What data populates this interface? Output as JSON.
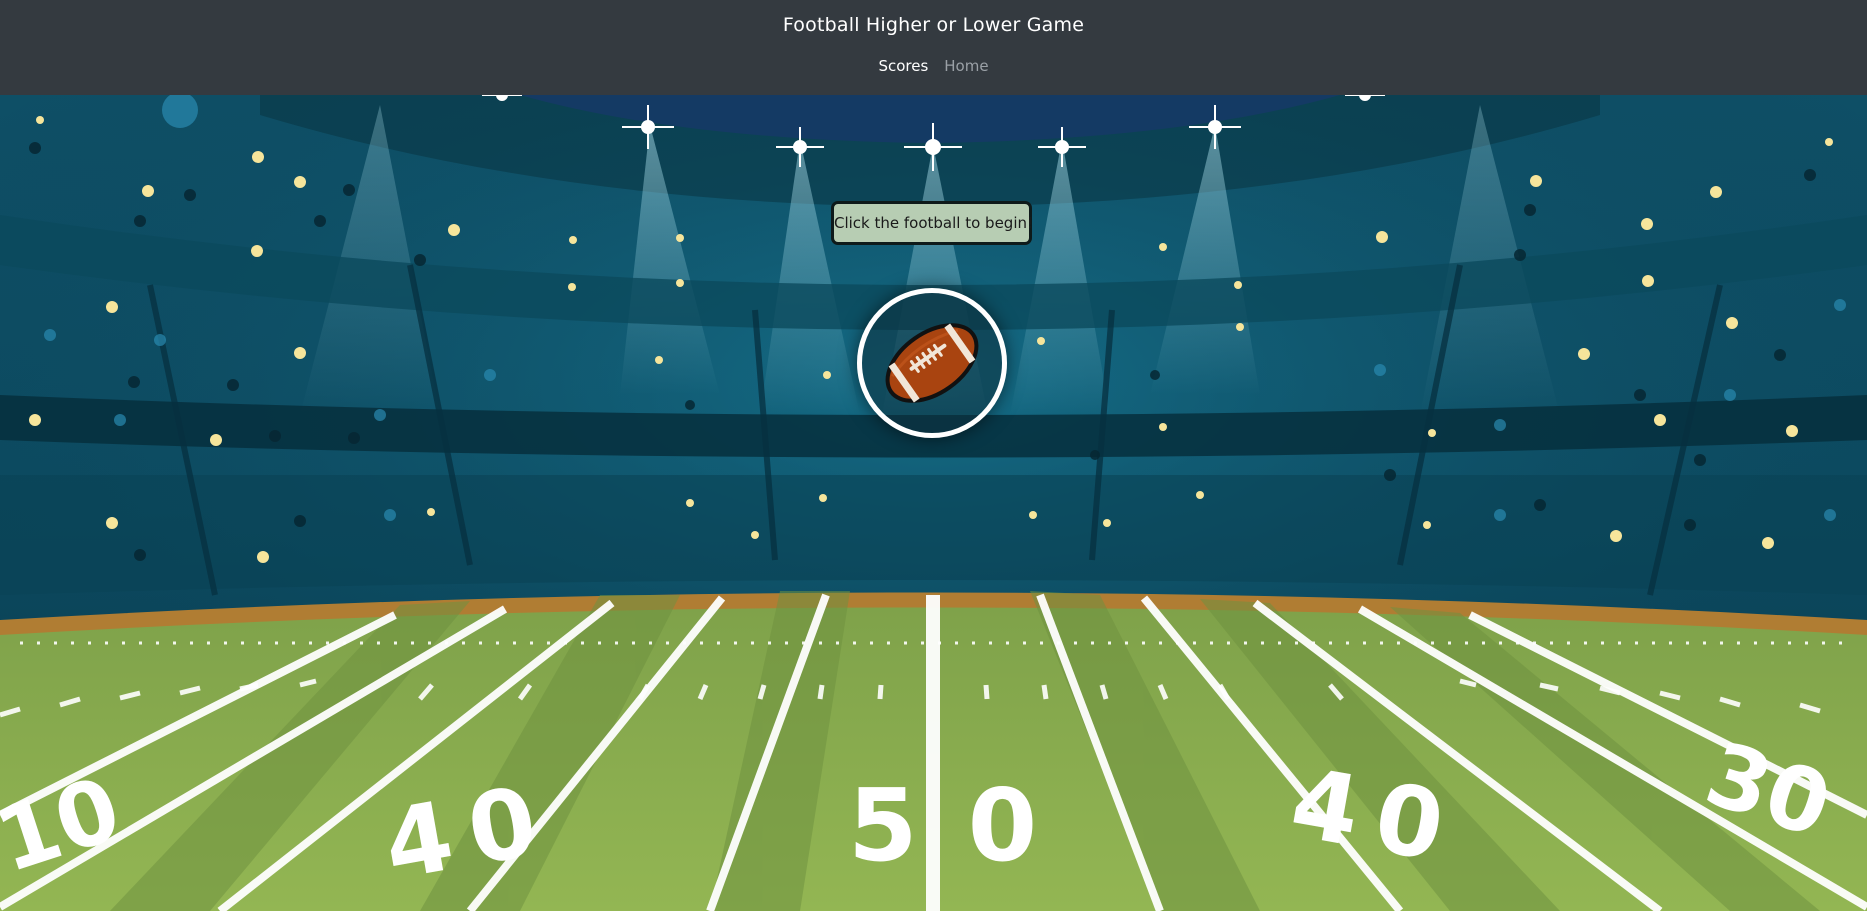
{
  "header": {
    "title": "Football Higher or Lower Game",
    "nav": [
      {
        "label": "Scores",
        "active": true
      },
      {
        "label": "Home",
        "active": false
      }
    ]
  },
  "game": {
    "prompt": "Click the football to begin!",
    "start_icon": "football-icon"
  },
  "field": {
    "yard_numbers": [
      "10",
      "40",
      "50",
      "40",
      "30"
    ]
  },
  "colors": {
    "navbar": "#343a40",
    "tooltip_bg": "#b7cdb3",
    "field_green": "#8fb04c",
    "stadium_teal": "#0f5c74",
    "football_brown": "#a94410"
  }
}
